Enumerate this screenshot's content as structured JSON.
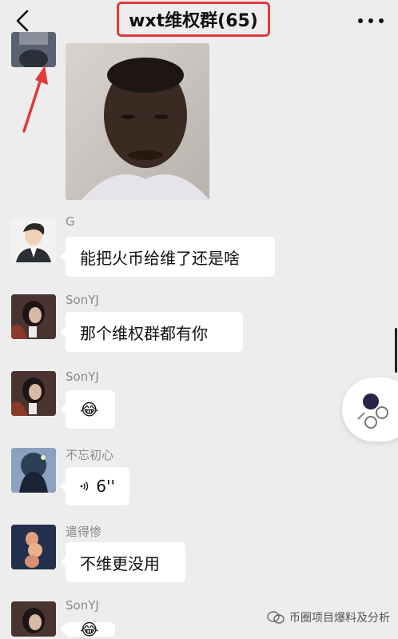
{
  "header": {
    "title": "wxt维权群(65)",
    "back_icon": "chevron-left-icon",
    "more_icon": "more-dots-icon",
    "highlight_color": "#e03a3a"
  },
  "messages": [
    {
      "sender": "",
      "type": "image"
    },
    {
      "sender": "G",
      "text": "能把火币给维了还是啥"
    },
    {
      "sender": "SonYJ",
      "text": "那个维权群都有你"
    },
    {
      "sender": "SonYJ",
      "text": "😂"
    },
    {
      "sender": "不忘初心",
      "text": "6''",
      "type": "voice"
    },
    {
      "sender": "遣得惨",
      "text": "不维更没用"
    },
    {
      "sender": "SonYJ",
      "text": "😂"
    }
  ],
  "annotation": {
    "arrow_color": "#e03a3a"
  },
  "watermark": {
    "text": "币圈项目爆料及分析"
  }
}
